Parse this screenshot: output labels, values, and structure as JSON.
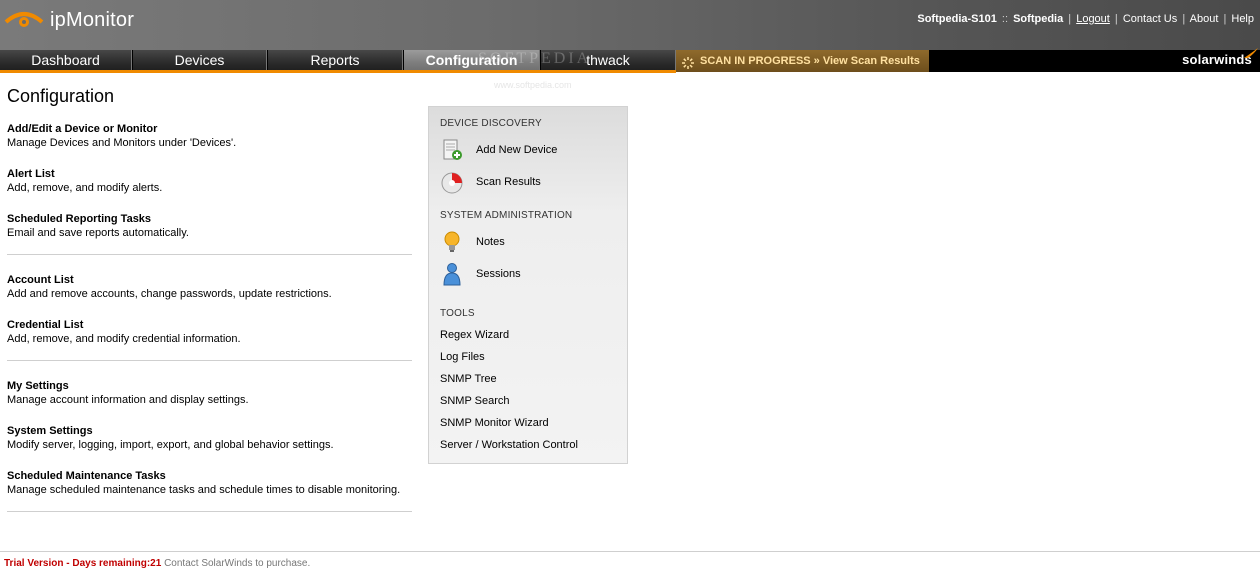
{
  "header": {
    "app_name": "ipMonitor",
    "server": "Softpedia-S101",
    "separator": "::",
    "user": "Softpedia",
    "links": [
      "Logout",
      "Contact Us",
      "About",
      "Help"
    ]
  },
  "nav": {
    "tabs": [
      {
        "label": "Dashboard",
        "active": false
      },
      {
        "label": "Devices",
        "active": false
      },
      {
        "label": "Reports",
        "active": false
      },
      {
        "label": "Configuration",
        "active": true
      },
      {
        "label": "thwack",
        "active": false
      }
    ],
    "scan_status": "SCAN IN PROGRESS » View Scan Results",
    "brand": "solarwinds"
  },
  "watermark": {
    "text": "SOFTPEDIA",
    "sub": "www.softpedia.com"
  },
  "page": {
    "title": "Configuration"
  },
  "config_groups": [
    [
      {
        "title": "Add/Edit a Device or Monitor",
        "desc": "Manage Devices and Monitors under 'Devices'."
      },
      {
        "title": "Alert List",
        "desc": "Add, remove, and modify alerts."
      },
      {
        "title": "Scheduled Reporting Tasks",
        "desc": "Email and save reports automatically."
      }
    ],
    [
      {
        "title": "Account List",
        "desc": "Add and remove accounts, change passwords, update restrictions."
      },
      {
        "title": "Credential List",
        "desc": "Add, remove, and modify credential information."
      }
    ],
    [
      {
        "title": "My Settings",
        "desc": "Manage account information and display settings."
      },
      {
        "title": "System Settings",
        "desc": "Modify server, logging, import, export, and global behavior settings."
      },
      {
        "title": "Scheduled Maintenance Tasks",
        "desc": "Manage scheduled maintenance tasks and schedule times to disable monitoring."
      }
    ]
  ],
  "side_panel": {
    "device_discovery": {
      "heading": "DEVICE DISCOVERY",
      "items": [
        {
          "label": "Add New Device",
          "icon": "add-device-icon"
        },
        {
          "label": "Scan Results",
          "icon": "scan-results-icon"
        }
      ]
    },
    "system_admin": {
      "heading": "SYSTEM ADMINISTRATION",
      "items": [
        {
          "label": "Notes",
          "icon": "lightbulb-icon"
        },
        {
          "label": "Sessions",
          "icon": "user-icon"
        }
      ]
    },
    "tools": {
      "heading": "TOOLS",
      "items": [
        "Regex Wizard",
        "Log Files",
        "SNMP Tree",
        "SNMP Search",
        "SNMP Monitor Wizard",
        "Server / Workstation Control"
      ]
    }
  },
  "footer": {
    "trial": "Trial Version - Days remaining:21",
    "contact": "Contact SolarWinds to purchase."
  },
  "colors": {
    "accent_orange": "#f08a00",
    "trial_red": "#c00000"
  }
}
